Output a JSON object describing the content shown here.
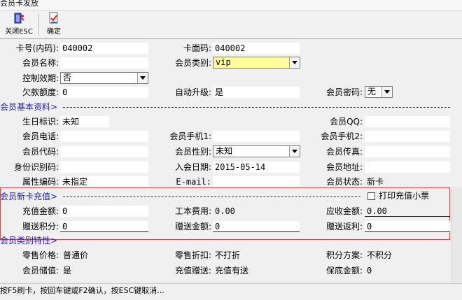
{
  "window": {
    "title": "会员卡发放"
  },
  "toolbar": {
    "close_label": "关闭ESC",
    "confirm_label": "确定"
  },
  "basic": {
    "card_no_label": "卡号(内码):",
    "card_no": "040002",
    "card_face_label": "卡面码:",
    "card_face": "040002",
    "member_name_label": "会员名称:",
    "member_name": "",
    "member_type_label": "会员类别:",
    "member_type": "vip",
    "control_validity_label": "控制效期:",
    "control_validity": "否",
    "debt_limit_label": "欠款额度:",
    "debt_limit": "0",
    "auto_upgrade_label": "自动升级:",
    "auto_upgrade": "是",
    "member_password_label": "会员密码:",
    "member_password": "无"
  },
  "profile": {
    "section_title": "会员基本资料>",
    "birthday_label": "生日标识:",
    "birthday": "未知",
    "qq_label": "会员QQ:",
    "qq": "",
    "phone_label": "会员电话:",
    "phone": "",
    "mobile1_label": "会员手机1:",
    "mobile1": "",
    "mobile2_label": "会员手机2:",
    "mobile2": "",
    "code_label": "会员代码:",
    "code": "",
    "gender_label": "会员性别:",
    "gender": "未知",
    "fax_label": "会员传真:",
    "fax": "",
    "id_label": "身份识别码:",
    "id": "",
    "join_date_label": "入会日期:",
    "join_date": "2015-05-14",
    "address_label": "会员地址:",
    "address": "",
    "attr_code_label": "属性编码:",
    "attr_code": "未指定",
    "email_label": "E-mail:",
    "email": "",
    "status_label": "会员状态:",
    "status": "新卡"
  },
  "recharge": {
    "section_title": "会员新卡充值>",
    "print_receipt_label": "打印充值小票",
    "amount_label": "充值金额:",
    "amount": "0",
    "fee_label": "工本费用:",
    "fee": "0.00",
    "receivable_label": "应收金额:",
    "receivable": "0.00",
    "bonus_points_label": "赠送积分:",
    "bonus_points": "0",
    "bonus_amount_label": "赠送金额:",
    "bonus_amount": "0",
    "bonus_rebate_label": "赠送返利:",
    "bonus_rebate": "0"
  },
  "category": {
    "section_title": "会员类别特性>",
    "sale_price_label": "零售价格:",
    "sale_price": "普通价",
    "discount_label": "零售折扣:",
    "discount": "不打折",
    "points_scheme_label": "积分方案:",
    "points_scheme": "不积分",
    "stored_value_label": "会员储值:",
    "stored_value": "是",
    "recharge_gift_label": "充值赠送:",
    "recharge_gift": "充值有送",
    "deposit_label": "保底金额:",
    "deposit": "0"
  },
  "status_bar": {
    "text": "按F5刷卡，按回车键或F2确认，按ESC键取消..."
  },
  "colors": {
    "section_blue": "#1a1ad6",
    "highlight_yellow": "#ffff99",
    "recharge_border": "#d94a4a"
  }
}
